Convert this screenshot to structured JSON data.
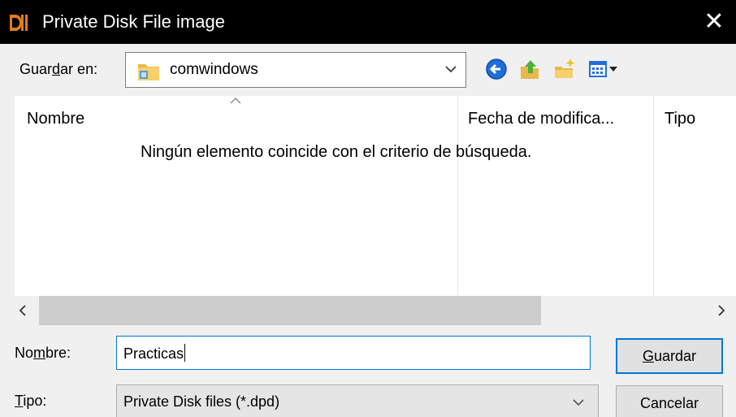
{
  "window": {
    "title": "Private Disk File image",
    "close_glyph": "✕"
  },
  "toolbar": {
    "save_in_prefix": "Guar",
    "save_in_access": "d",
    "save_in_suffix": "ar en:",
    "folder_value": "comwindows",
    "icons": [
      "back-icon",
      "up-folder-icon",
      "new-folder-icon",
      "view-menu-icon"
    ]
  },
  "file_list": {
    "columns": [
      "Nombre",
      "Fecha de modifica...",
      "Tipo"
    ],
    "empty_message": "Ningún elemento coincide con el criterio de búsqueda."
  },
  "file_name": {
    "label_prefix": "No",
    "label_access": "m",
    "label_suffix": "bre:",
    "value": "Practicas"
  },
  "file_type": {
    "label_access": "T",
    "label_suffix": "ipo:",
    "value": "Private Disk files (*.dpd)"
  },
  "buttons": {
    "save_access": "G",
    "save_suffix": "uardar",
    "cancel": "Cancelar"
  },
  "colors": {
    "accent": "#0078d7",
    "titlebar": "#000000",
    "dialog_bg": "#f0f0f0"
  }
}
